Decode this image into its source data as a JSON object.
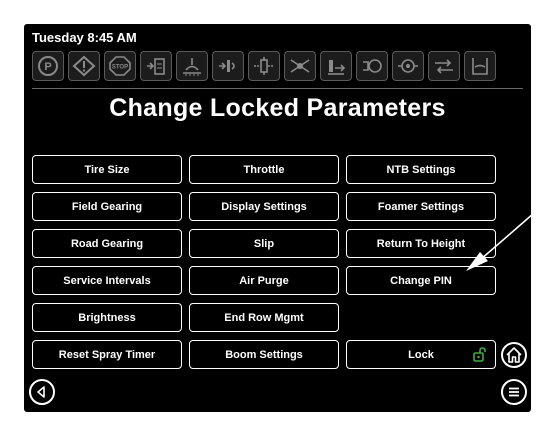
{
  "status": {
    "datetime": "Tuesday 8:45 AM"
  },
  "status_icons": [
    "parking-brake-icon",
    "warning-icon",
    "stop-icon",
    "tank-level-icon",
    "agitator-icon",
    "boom-left-icon",
    "boom-center-icon",
    "boom-fold-icon",
    "flow-rate-icon",
    "valve-icon",
    "pressure-icon",
    "rinse-icon",
    "foam-tank-icon"
  ],
  "page": {
    "title": "Change Locked Parameters"
  },
  "buttons": {
    "tire_size": "Tire Size",
    "throttle": "Throttle",
    "ntb_settings": "NTB Settings",
    "field_gearing": "Field Gearing",
    "display_settings": "Display Settings",
    "foamer_settings": "Foamer Settings",
    "road_gearing": "Road Gearing",
    "slip": "Slip",
    "return_to_height": "Return To Height",
    "service_intervals": "Service Intervals",
    "air_purge": "Air Purge",
    "change_pin": "Change PIN",
    "brightness": "Brightness",
    "end_row_mgmt": "End Row Mgmt",
    "reset_spray_timer": "Reset Spray Timer",
    "boom_settings": "Boom Settings",
    "lock": "Lock"
  },
  "nav": {
    "home": "home-icon",
    "back": "back-arrow-icon",
    "menu": "menu-icon"
  },
  "colors": {
    "background": "#000000",
    "text": "#ffffff",
    "lock_icon": "#3cb043"
  }
}
